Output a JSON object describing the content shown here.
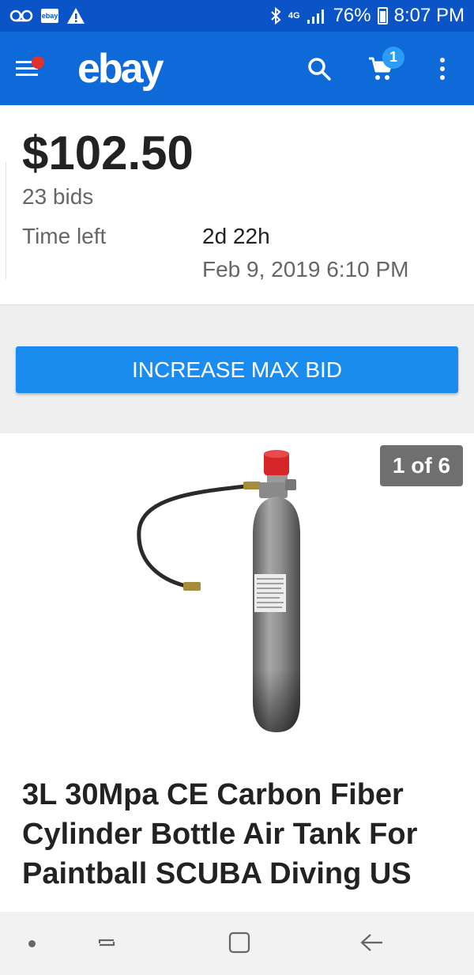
{
  "status_bar": {
    "battery": "76%",
    "time": "8:07 PM",
    "ebay_notice": "ebay",
    "network": "4G"
  },
  "app_bar": {
    "logo": "ebay",
    "cart_count": "1"
  },
  "listing": {
    "price": "$102.50",
    "bids": "23 bids",
    "time_left_label": "Time left",
    "time_left_value": "2d 22h",
    "end_date": "Feb 9, 2019 6:10 PM",
    "action_button": "INCREASE MAX BID",
    "image_counter": "1 of 6",
    "title": "3L 30Mpa CE Carbon Fiber Cylinder Bottle Air Tank For Paintball SCUBA Diving US"
  },
  "colors": {
    "status_bar": "#0b54c8",
    "app_bar": "#0e6ad8",
    "button": "#1a8cf0",
    "badge": "#2d9cf6",
    "notification_dot": "#e0322b"
  }
}
